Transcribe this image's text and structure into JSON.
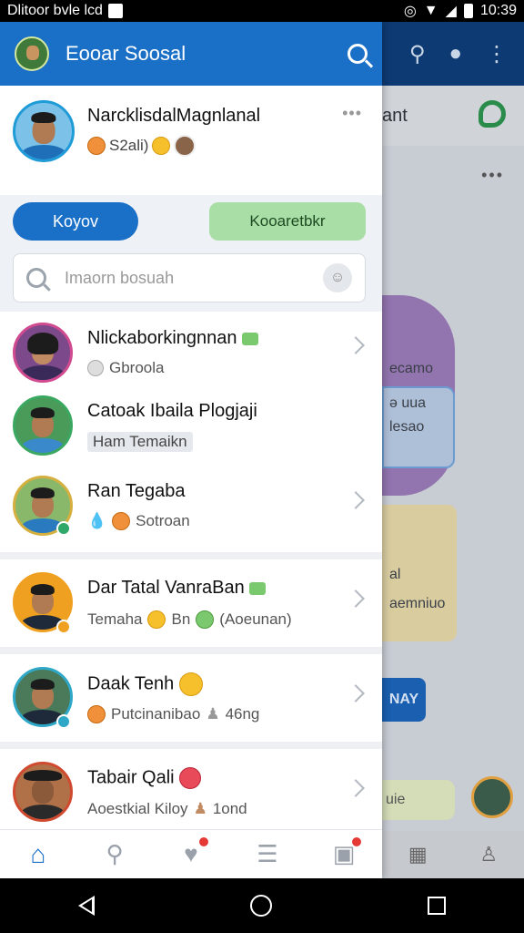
{
  "status_bar": {
    "left_text": "Dlitoor bvle lcd",
    "time": "10:39"
  },
  "background_app": {
    "row_text": "ant",
    "card_text_1": "ecamo",
    "card_text_2": "ə uua",
    "card_text_3": "lesao",
    "card_text_4": "al",
    "card_text_5": "aemniuo",
    "button_text": "NAY",
    "input_text": "uie"
  },
  "drawer": {
    "app_title": "Eooar Soosal",
    "profile": {
      "name": "Narcklisdal​Magnlanal",
      "meta_text": "S2ali)",
      "more": "•••"
    },
    "primary_button": "Koyov",
    "secondary_button": "Kooaretbkr",
    "search": {
      "placeholder": "Imaorn bosuah"
    },
    "contacts": [
      {
        "name": "Nlickaborkingnnan",
        "status": "Gbroola"
      },
      {
        "name": "Catoak Ibaila Plogjaji",
        "status": "Ham Temaikn"
      },
      {
        "name": "Ran Tegaba",
        "status": "Sotroan"
      },
      {
        "name": "Dar Tatal VanraBan",
        "status_a": "Temaha",
        "status_b": "Bn",
        "status_c": "(Aoeunan)"
      },
      {
        "name": "Daak Tenh",
        "status": "Putcinanibao",
        "status_extra": "46ng"
      },
      {
        "name": "Tabair Qali",
        "status": "Aoestkial Kiloy",
        "status_extra": "1ond"
      }
    ]
  },
  "colors": {
    "accent": "#1a6fc7",
    "secondary_button": "#a9dfa6",
    "badge": "#e53935"
  }
}
